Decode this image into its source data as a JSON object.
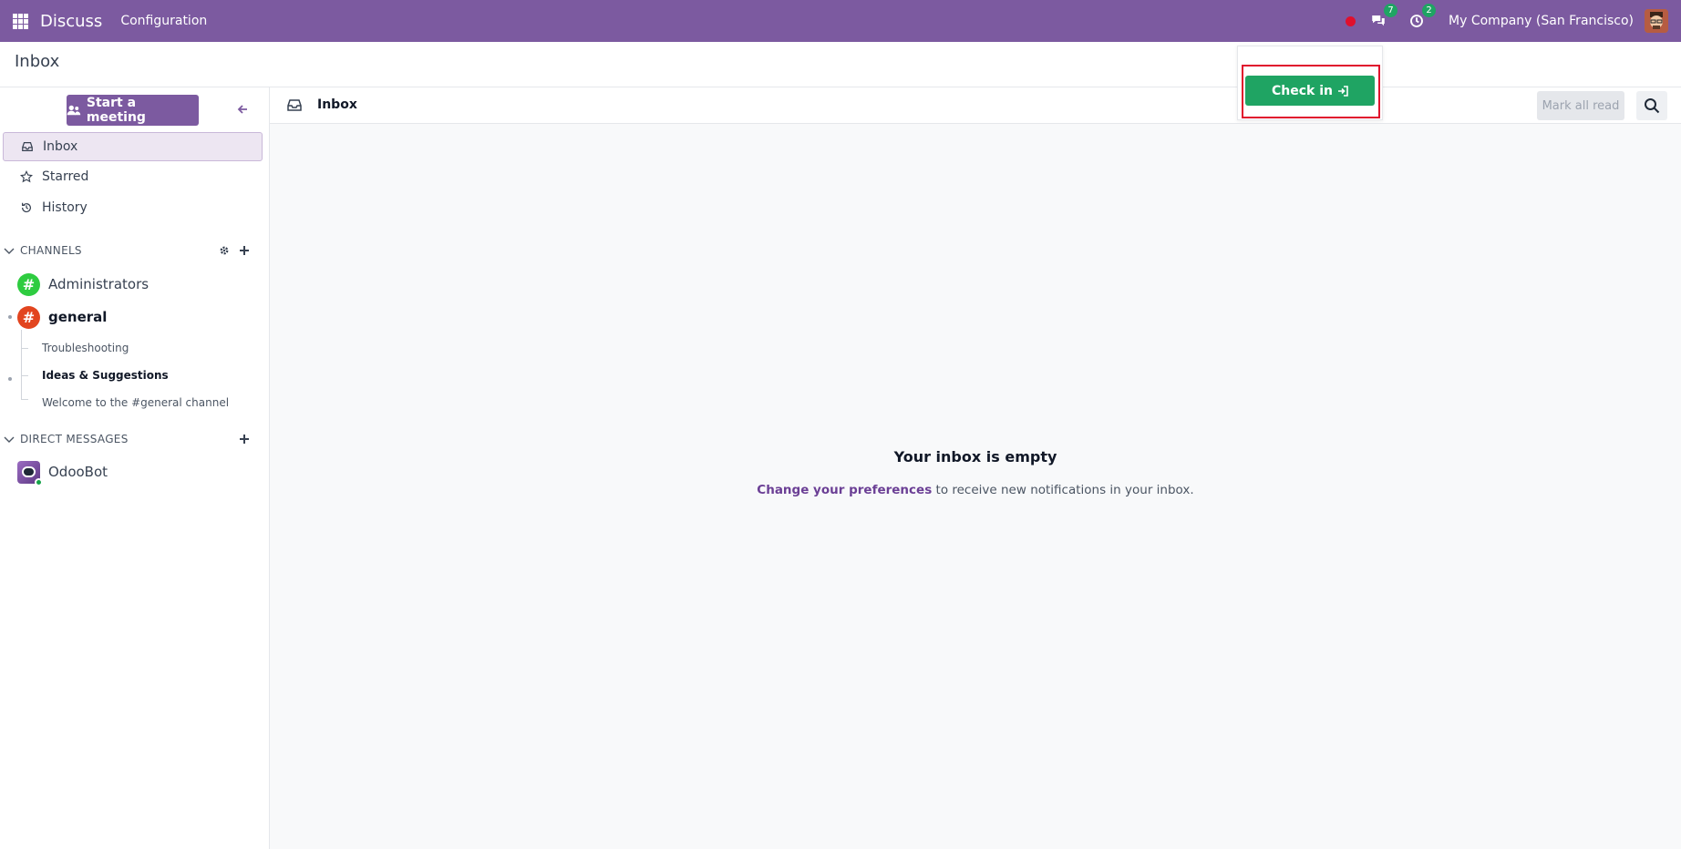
{
  "navbar": {
    "app_name": "Discuss",
    "menu_configuration": "Configuration",
    "messages_count": "7",
    "activities_count": "2",
    "company": "My Company (San Francisco)"
  },
  "page": {
    "title": "Inbox"
  },
  "sidebar": {
    "start_meeting_label": "Start a meeting",
    "mailboxes": [
      {
        "label": "Inbox",
        "icon": "inbox-icon",
        "active": true
      },
      {
        "label": "Starred",
        "icon": "star-icon",
        "active": false
      },
      {
        "label": "History",
        "icon": "history-icon",
        "active": false
      }
    ],
    "channels_header": "CHANNELS",
    "channels": [
      {
        "label": "Administrators",
        "color": "#2ecc40",
        "bold": false
      },
      {
        "label": "general",
        "color": "#e2451f",
        "bold": true
      }
    ],
    "sub_threads": [
      {
        "label": "Troubleshooting",
        "bold": false
      },
      {
        "label": "Ideas & Suggestions",
        "bold": true
      },
      {
        "label": "Welcome to the #general channel",
        "bold": false
      }
    ],
    "direct_messages_header": "DIRECT MESSAGES",
    "direct_messages": [
      {
        "label": "OdooBot"
      }
    ]
  },
  "thread": {
    "title": "Inbox",
    "mark_all_read_label": "Mark all read",
    "empty_title": "Your inbox is empty",
    "empty_link": "Change your preferences",
    "empty_text": " to receive new notifications in your inbox."
  },
  "popover": {
    "check_in_label": "Check in"
  },
  "colors": {
    "brand": "#7c5aa0",
    "success": "#1fa463",
    "highlight": "#e0102d"
  }
}
